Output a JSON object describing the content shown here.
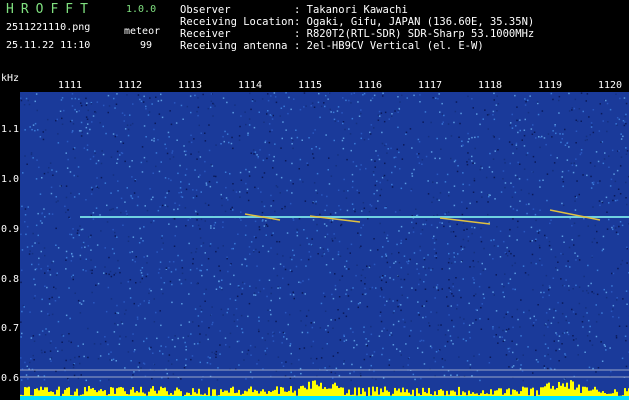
{
  "header": {
    "app_name": "HROFFT",
    "version": "1.0.0",
    "filename": "2511221110.png",
    "datetime": "25.11.22 11:10",
    "meteor_label": "meteor",
    "meteor_count": "99"
  },
  "info": [
    {
      "key": "Observer",
      "value": ": Takanori Kawachi"
    },
    {
      "key": "Receiving Location",
      "value": ": Ogaki, Gifu, JAPAN (136.60E, 35.35N)"
    },
    {
      "key": "Receiver",
      "value": ": R820T2(RTL-SDR) SDR-Sharp 53.1000MHz"
    },
    {
      "key": "Receiving antenna",
      "value": ": 2el-HB9CV Vertical (el. E-W)"
    }
  ],
  "axis": {
    "y_unit": "kHz",
    "x_ticks": [
      "1111",
      "1112",
      "1113",
      "1114",
      "1115",
      "1116",
      "1117",
      "1118",
      "1119",
      "1120"
    ],
    "y_ticks": [
      "1.1",
      "1.0",
      "0.9",
      "0.8",
      "0.7",
      "0.6"
    ]
  },
  "colors": {
    "background": "#000000",
    "spectrogram": "#1a3a9a",
    "carrier": "#6fd0e0",
    "meteor_band": "#ffff00",
    "baseline": "#00e0ff",
    "title": "#7fe07f"
  }
}
